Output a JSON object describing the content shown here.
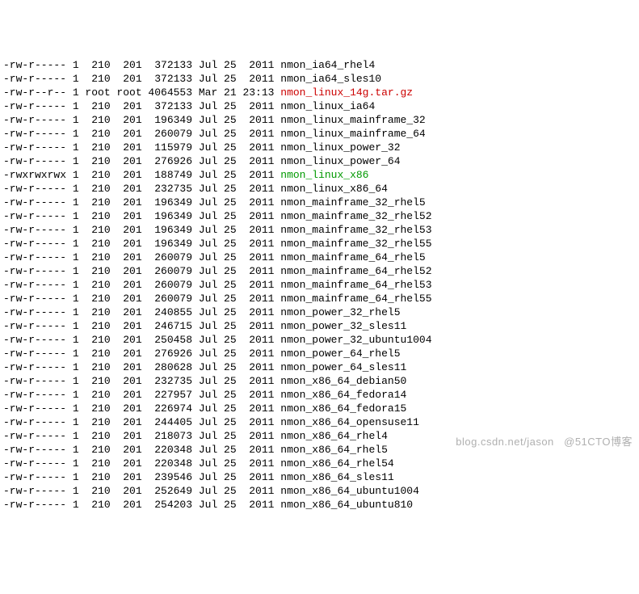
{
  "watermark": "blog.csdn.net/jason   @51CTO博客",
  "listing": [
    {
      "perms": "-rw-r-----",
      "links": "1",
      "owner": " 210",
      "group": " 201",
      "size": " 372133",
      "date": "Jul 25  2011",
      "name": "nmon_ia64_rhel4",
      "color": ""
    },
    {
      "perms": "-rw-r-----",
      "links": "1",
      "owner": " 210",
      "group": " 201",
      "size": " 372133",
      "date": "Jul 25  2011",
      "name": "nmon_ia64_sles10",
      "color": ""
    },
    {
      "perms": "-rw-r--r--",
      "links": "1",
      "owner": "root",
      "group": "root",
      "size": "4064553",
      "date": "Mar 21 23:13",
      "name": "nmon_linux_14g.tar.gz",
      "color": "red"
    },
    {
      "perms": "-rw-r-----",
      "links": "1",
      "owner": " 210",
      "group": " 201",
      "size": " 372133",
      "date": "Jul 25  2011",
      "name": "nmon_linux_ia64",
      "color": ""
    },
    {
      "perms": "-rw-r-----",
      "links": "1",
      "owner": " 210",
      "group": " 201",
      "size": " 196349",
      "date": "Jul 25  2011",
      "name": "nmon_linux_mainframe_32",
      "color": ""
    },
    {
      "perms": "-rw-r-----",
      "links": "1",
      "owner": " 210",
      "group": " 201",
      "size": " 260079",
      "date": "Jul 25  2011",
      "name": "nmon_linux_mainframe_64",
      "color": ""
    },
    {
      "perms": "-rw-r-----",
      "links": "1",
      "owner": " 210",
      "group": " 201",
      "size": " 115979",
      "date": "Jul 25  2011",
      "name": "nmon_linux_power_32",
      "color": ""
    },
    {
      "perms": "-rw-r-----",
      "links": "1",
      "owner": " 210",
      "group": " 201",
      "size": " 276926",
      "date": "Jul 25  2011",
      "name": "nmon_linux_power_64",
      "color": ""
    },
    {
      "perms": "-rwxrwxrwx",
      "links": "1",
      "owner": " 210",
      "group": " 201",
      "size": " 188749",
      "date": "Jul 25  2011",
      "name": "nmon_linux_x86",
      "color": "green"
    },
    {
      "perms": "-rw-r-----",
      "links": "1",
      "owner": " 210",
      "group": " 201",
      "size": " 232735",
      "date": "Jul 25  2011",
      "name": "nmon_linux_x86_64",
      "color": ""
    },
    {
      "perms": "-rw-r-----",
      "links": "1",
      "owner": " 210",
      "group": " 201",
      "size": " 196349",
      "date": "Jul 25  2011",
      "name": "nmon_mainframe_32_rhel5",
      "color": ""
    },
    {
      "perms": "-rw-r-----",
      "links": "1",
      "owner": " 210",
      "group": " 201",
      "size": " 196349",
      "date": "Jul 25  2011",
      "name": "nmon_mainframe_32_rhel52",
      "color": ""
    },
    {
      "perms": "-rw-r-----",
      "links": "1",
      "owner": " 210",
      "group": " 201",
      "size": " 196349",
      "date": "Jul 25  2011",
      "name": "nmon_mainframe_32_rhel53",
      "color": ""
    },
    {
      "perms": "-rw-r-----",
      "links": "1",
      "owner": " 210",
      "group": " 201",
      "size": " 196349",
      "date": "Jul 25  2011",
      "name": "nmon_mainframe_32_rhel55",
      "color": ""
    },
    {
      "perms": "-rw-r-----",
      "links": "1",
      "owner": " 210",
      "group": " 201",
      "size": " 260079",
      "date": "Jul 25  2011",
      "name": "nmon_mainframe_64_rhel5",
      "color": ""
    },
    {
      "perms": "-rw-r-----",
      "links": "1",
      "owner": " 210",
      "group": " 201",
      "size": " 260079",
      "date": "Jul 25  2011",
      "name": "nmon_mainframe_64_rhel52",
      "color": ""
    },
    {
      "perms": "-rw-r-----",
      "links": "1",
      "owner": " 210",
      "group": " 201",
      "size": " 260079",
      "date": "Jul 25  2011",
      "name": "nmon_mainframe_64_rhel53",
      "color": ""
    },
    {
      "perms": "-rw-r-----",
      "links": "1",
      "owner": " 210",
      "group": " 201",
      "size": " 260079",
      "date": "Jul 25  2011",
      "name": "nmon_mainframe_64_rhel55",
      "color": ""
    },
    {
      "perms": "-rw-r-----",
      "links": "1",
      "owner": " 210",
      "group": " 201",
      "size": " 240855",
      "date": "Jul 25  2011",
      "name": "nmon_power_32_rhel5",
      "color": ""
    },
    {
      "perms": "-rw-r-----",
      "links": "1",
      "owner": " 210",
      "group": " 201",
      "size": " 246715",
      "date": "Jul 25  2011",
      "name": "nmon_power_32_sles11",
      "color": ""
    },
    {
      "perms": "-rw-r-----",
      "links": "1",
      "owner": " 210",
      "group": " 201",
      "size": " 250458",
      "date": "Jul 25  2011",
      "name": "nmon_power_32_ubuntu1004",
      "color": ""
    },
    {
      "perms": "-rw-r-----",
      "links": "1",
      "owner": " 210",
      "group": " 201",
      "size": " 276926",
      "date": "Jul 25  2011",
      "name": "nmon_power_64_rhel5",
      "color": ""
    },
    {
      "perms": "-rw-r-----",
      "links": "1",
      "owner": " 210",
      "group": " 201",
      "size": " 280628",
      "date": "Jul 25  2011",
      "name": "nmon_power_64_sles11",
      "color": ""
    },
    {
      "perms": "-rw-r-----",
      "links": "1",
      "owner": " 210",
      "group": " 201",
      "size": " 232735",
      "date": "Jul 25  2011",
      "name": "nmon_x86_64_debian50",
      "color": ""
    },
    {
      "perms": "-rw-r-----",
      "links": "1",
      "owner": " 210",
      "group": " 201",
      "size": " 227957",
      "date": "Jul 25  2011",
      "name": "nmon_x86_64_fedora14",
      "color": ""
    },
    {
      "perms": "-rw-r-----",
      "links": "1",
      "owner": " 210",
      "group": " 201",
      "size": " 226974",
      "date": "Jul 25  2011",
      "name": "nmon_x86_64_fedora15",
      "color": ""
    },
    {
      "perms": "-rw-r-----",
      "links": "1",
      "owner": " 210",
      "group": " 201",
      "size": " 244405",
      "date": "Jul 25  2011",
      "name": "nmon_x86_64_opensuse11",
      "color": ""
    },
    {
      "perms": "-rw-r-----",
      "links": "1",
      "owner": " 210",
      "group": " 201",
      "size": " 218073",
      "date": "Jul 25  2011",
      "name": "nmon_x86_64_rhel4",
      "color": ""
    },
    {
      "perms": "-rw-r-----",
      "links": "1",
      "owner": " 210",
      "group": " 201",
      "size": " 220348",
      "date": "Jul 25  2011",
      "name": "nmon_x86_64_rhel5",
      "color": ""
    },
    {
      "perms": "-rw-r-----",
      "links": "1",
      "owner": " 210",
      "group": " 201",
      "size": " 220348",
      "date": "Jul 25  2011",
      "name": "nmon_x86_64_rhel54",
      "color": ""
    },
    {
      "perms": "-rw-r-----",
      "links": "1",
      "owner": " 210",
      "group": " 201",
      "size": " 239546",
      "date": "Jul 25  2011",
      "name": "nmon_x86_64_sles11",
      "color": ""
    },
    {
      "perms": "-rw-r-----",
      "links": "1",
      "owner": " 210",
      "group": " 201",
      "size": " 252649",
      "date": "Jul 25  2011",
      "name": "nmon_x86_64_ubuntu1004",
      "color": ""
    },
    {
      "perms": "-rw-r-----",
      "links": "1",
      "owner": " 210",
      "group": " 201",
      "size": " 254203",
      "date": "Jul 25  2011",
      "name": "nmon_x86_64_ubuntu810",
      "color": ""
    }
  ]
}
